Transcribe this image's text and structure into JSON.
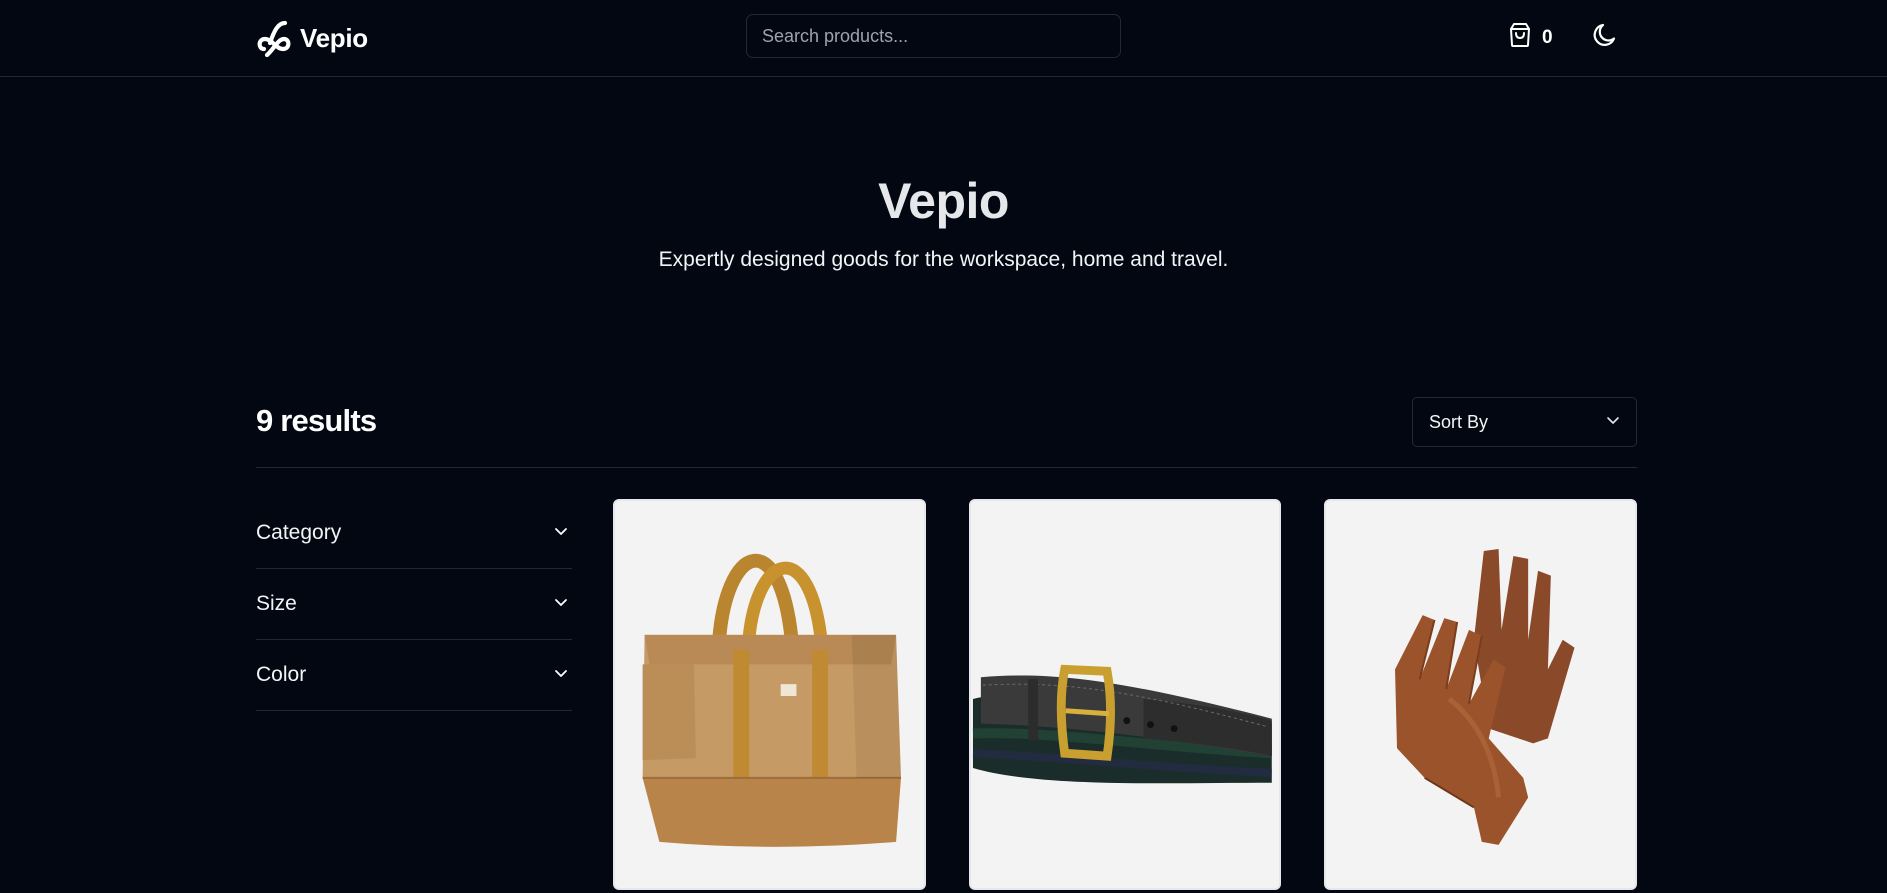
{
  "header": {
    "brand": "Vepio",
    "search_placeholder": "Search products...",
    "cart_count": "0",
    "icons": {
      "logo": "infinity-f-logo-icon",
      "cart": "shopping-bag-icon",
      "theme": "moon-icon"
    }
  },
  "hero": {
    "title": "Vepio",
    "subtitle": "Expertly designed goods for the workspace, home and travel."
  },
  "results": {
    "count_label": "9 results",
    "sort_label": "Sort By"
  },
  "filters": [
    {
      "label": "Category"
    },
    {
      "label": "Size"
    },
    {
      "label": "Color"
    }
  ],
  "products": [
    {
      "image": "canvas-tote-bag"
    },
    {
      "image": "leather-belt-with-brass-buckle"
    },
    {
      "image": "brown-leather-gloves"
    }
  ],
  "colors": {
    "background": "#030712",
    "border": "#1f2937",
    "text": "#f3f4f6",
    "card_bg": "#f3f3f3"
  }
}
